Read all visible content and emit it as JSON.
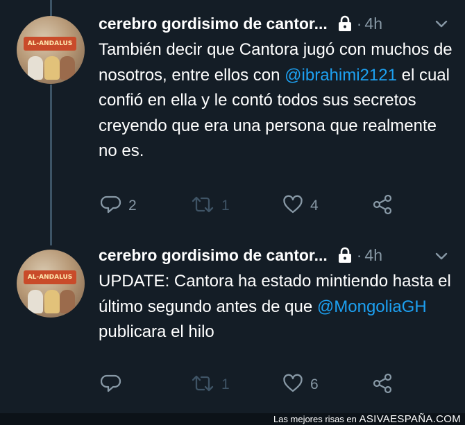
{
  "tweets": [
    {
      "author": "cerebro gordisimo de cantor...",
      "avatar_text": "AL-ANDALUS",
      "separator": "·",
      "time": "4h",
      "text_before": "También decir que Cantora jugó con muchos de nosotros, entre ellos con ",
      "mention": "@ibrahimi2121",
      "text_after": " el cual confió en ella y le contó todos sus secretos creyendo que era una persona que realmente no es.",
      "replies": "2",
      "retweets": "1",
      "likes": "4"
    },
    {
      "author": "cerebro gordisimo de cantor...",
      "avatar_text": "AL-ANDALUS",
      "separator": "·",
      "time": "4h",
      "text_before": "UPDATE: Cantora ha estado mintiendo hasta el último segundo antes de que ",
      "mention": "@MongoliaGH",
      "text_after": " publicara el hilo",
      "replies": "",
      "retweets": "1",
      "likes": "6"
    }
  ],
  "icons": {
    "reply": "reply-icon",
    "retweet": "retweet-icon",
    "like": "heart-icon",
    "share": "share-icon",
    "lock": "lock-icon",
    "more": "chevron-down-icon"
  },
  "colors": {
    "background": "#141d26",
    "mention": "#1da1f2",
    "muted": "#8899a6"
  },
  "watermark": {
    "prefix": "Las mejores risas en",
    "site": "ASIVAESPAÑA.COM"
  }
}
